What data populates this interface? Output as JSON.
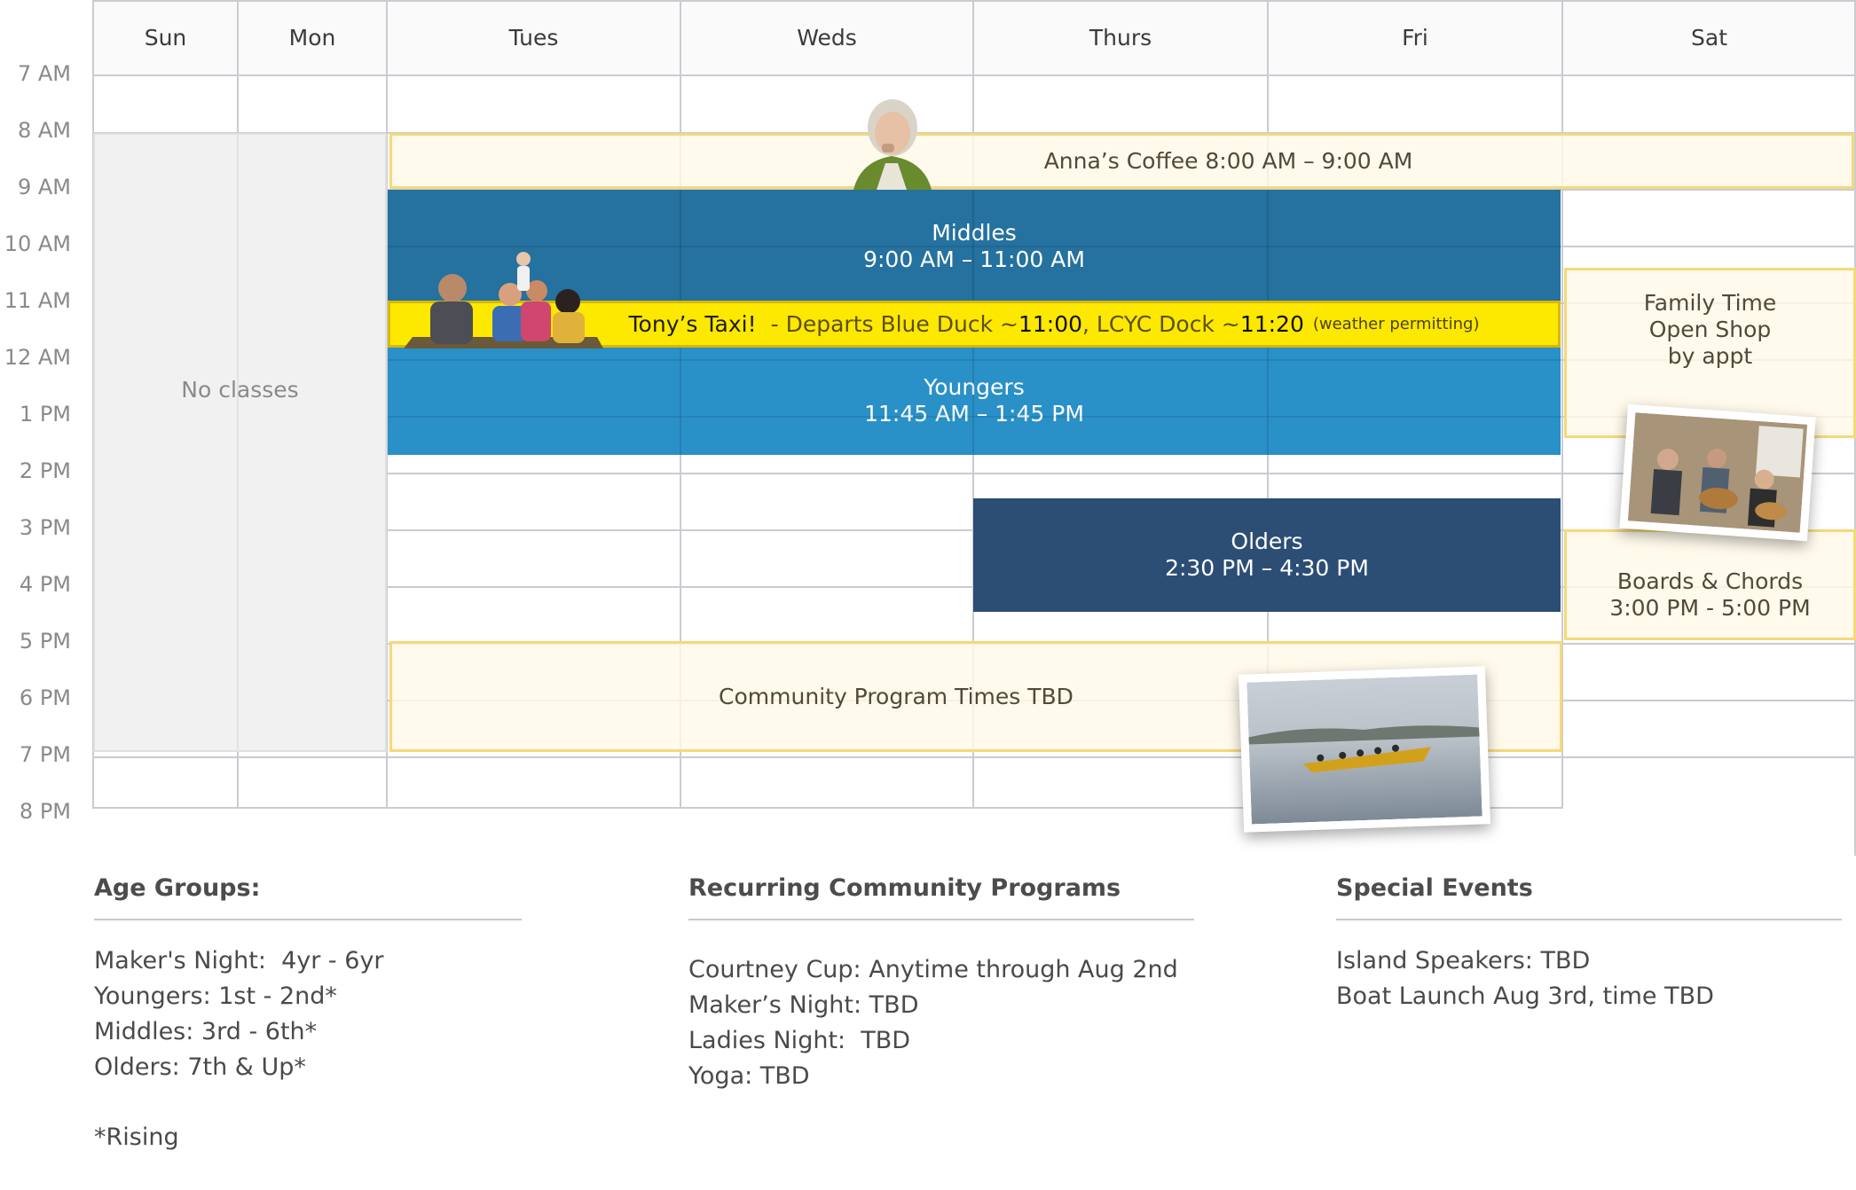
{
  "calendar": {
    "days": [
      "Sun",
      "Mon",
      "Tues",
      "Weds",
      "Thurs",
      "Fri",
      "Sat"
    ],
    "times": [
      "7 AM",
      "8 AM",
      "9 AM",
      "10 AM",
      "11 AM",
      "12 AM",
      "1 PM",
      "2 PM",
      "3 PM",
      "4 PM",
      "5 PM",
      "6 PM",
      "7 PM",
      "8 PM"
    ],
    "no_classes": "No classes",
    "events": {
      "annas_coffee": "Anna’s Coffee 8:00 AM – 9:00 AM",
      "middles_title": "Middles",
      "middles_time": "9:00 AM – 11:00 AM",
      "taxi_a": "Tony’s Taxi!",
      "taxi_b": "- Departs Blue Duck ~",
      "taxi_c": "11:00",
      "taxi_d": ", LCYC Dock ~",
      "taxi_e": "11:20",
      "taxi_f": "(weather permitting)",
      "youngers_title": "Youngers",
      "youngers_time": "11:45 AM – 1:45 PM",
      "olders_title": "Olders",
      "olders_time": "2:30 PM – 4:30 PM",
      "community": "Community Program Times TBD",
      "family_1": "Family Time",
      "family_2": "Open Shop",
      "family_3": "by appt",
      "boards_title": "Boards & Chords",
      "boards_time": "3:00 PM - 5:00 PM"
    }
  },
  "age_groups": {
    "title": "Age Groups:",
    "items": [
      "Maker's Night:  4yr - 6yr",
      "Youngers: 1st - 2nd*",
      "Middles: 3rd - 6th*",
      "Olders: 7th & Up*"
    ],
    "note": "*Rising"
  },
  "recurring": {
    "title": "Recurring Community Programs",
    "items": [
      "Courtney Cup: Anytime through Aug 2nd",
      "Maker’s Night: TBD",
      "Ladies Night:  TBD",
      "Yoga: TBD"
    ]
  },
  "special": {
    "title": "Special Events",
    "items": [
      "Island Speakers: TBD",
      "Boat Launch Aug 3rd, time TBD"
    ]
  },
  "colors": {
    "middles": "#1e6c9c",
    "youngers": "#238cc6",
    "olders": "#2c4e75",
    "taxi": "#fde800",
    "tan_fill": "#fff9e6",
    "tan_border": "#f6d87a"
  }
}
